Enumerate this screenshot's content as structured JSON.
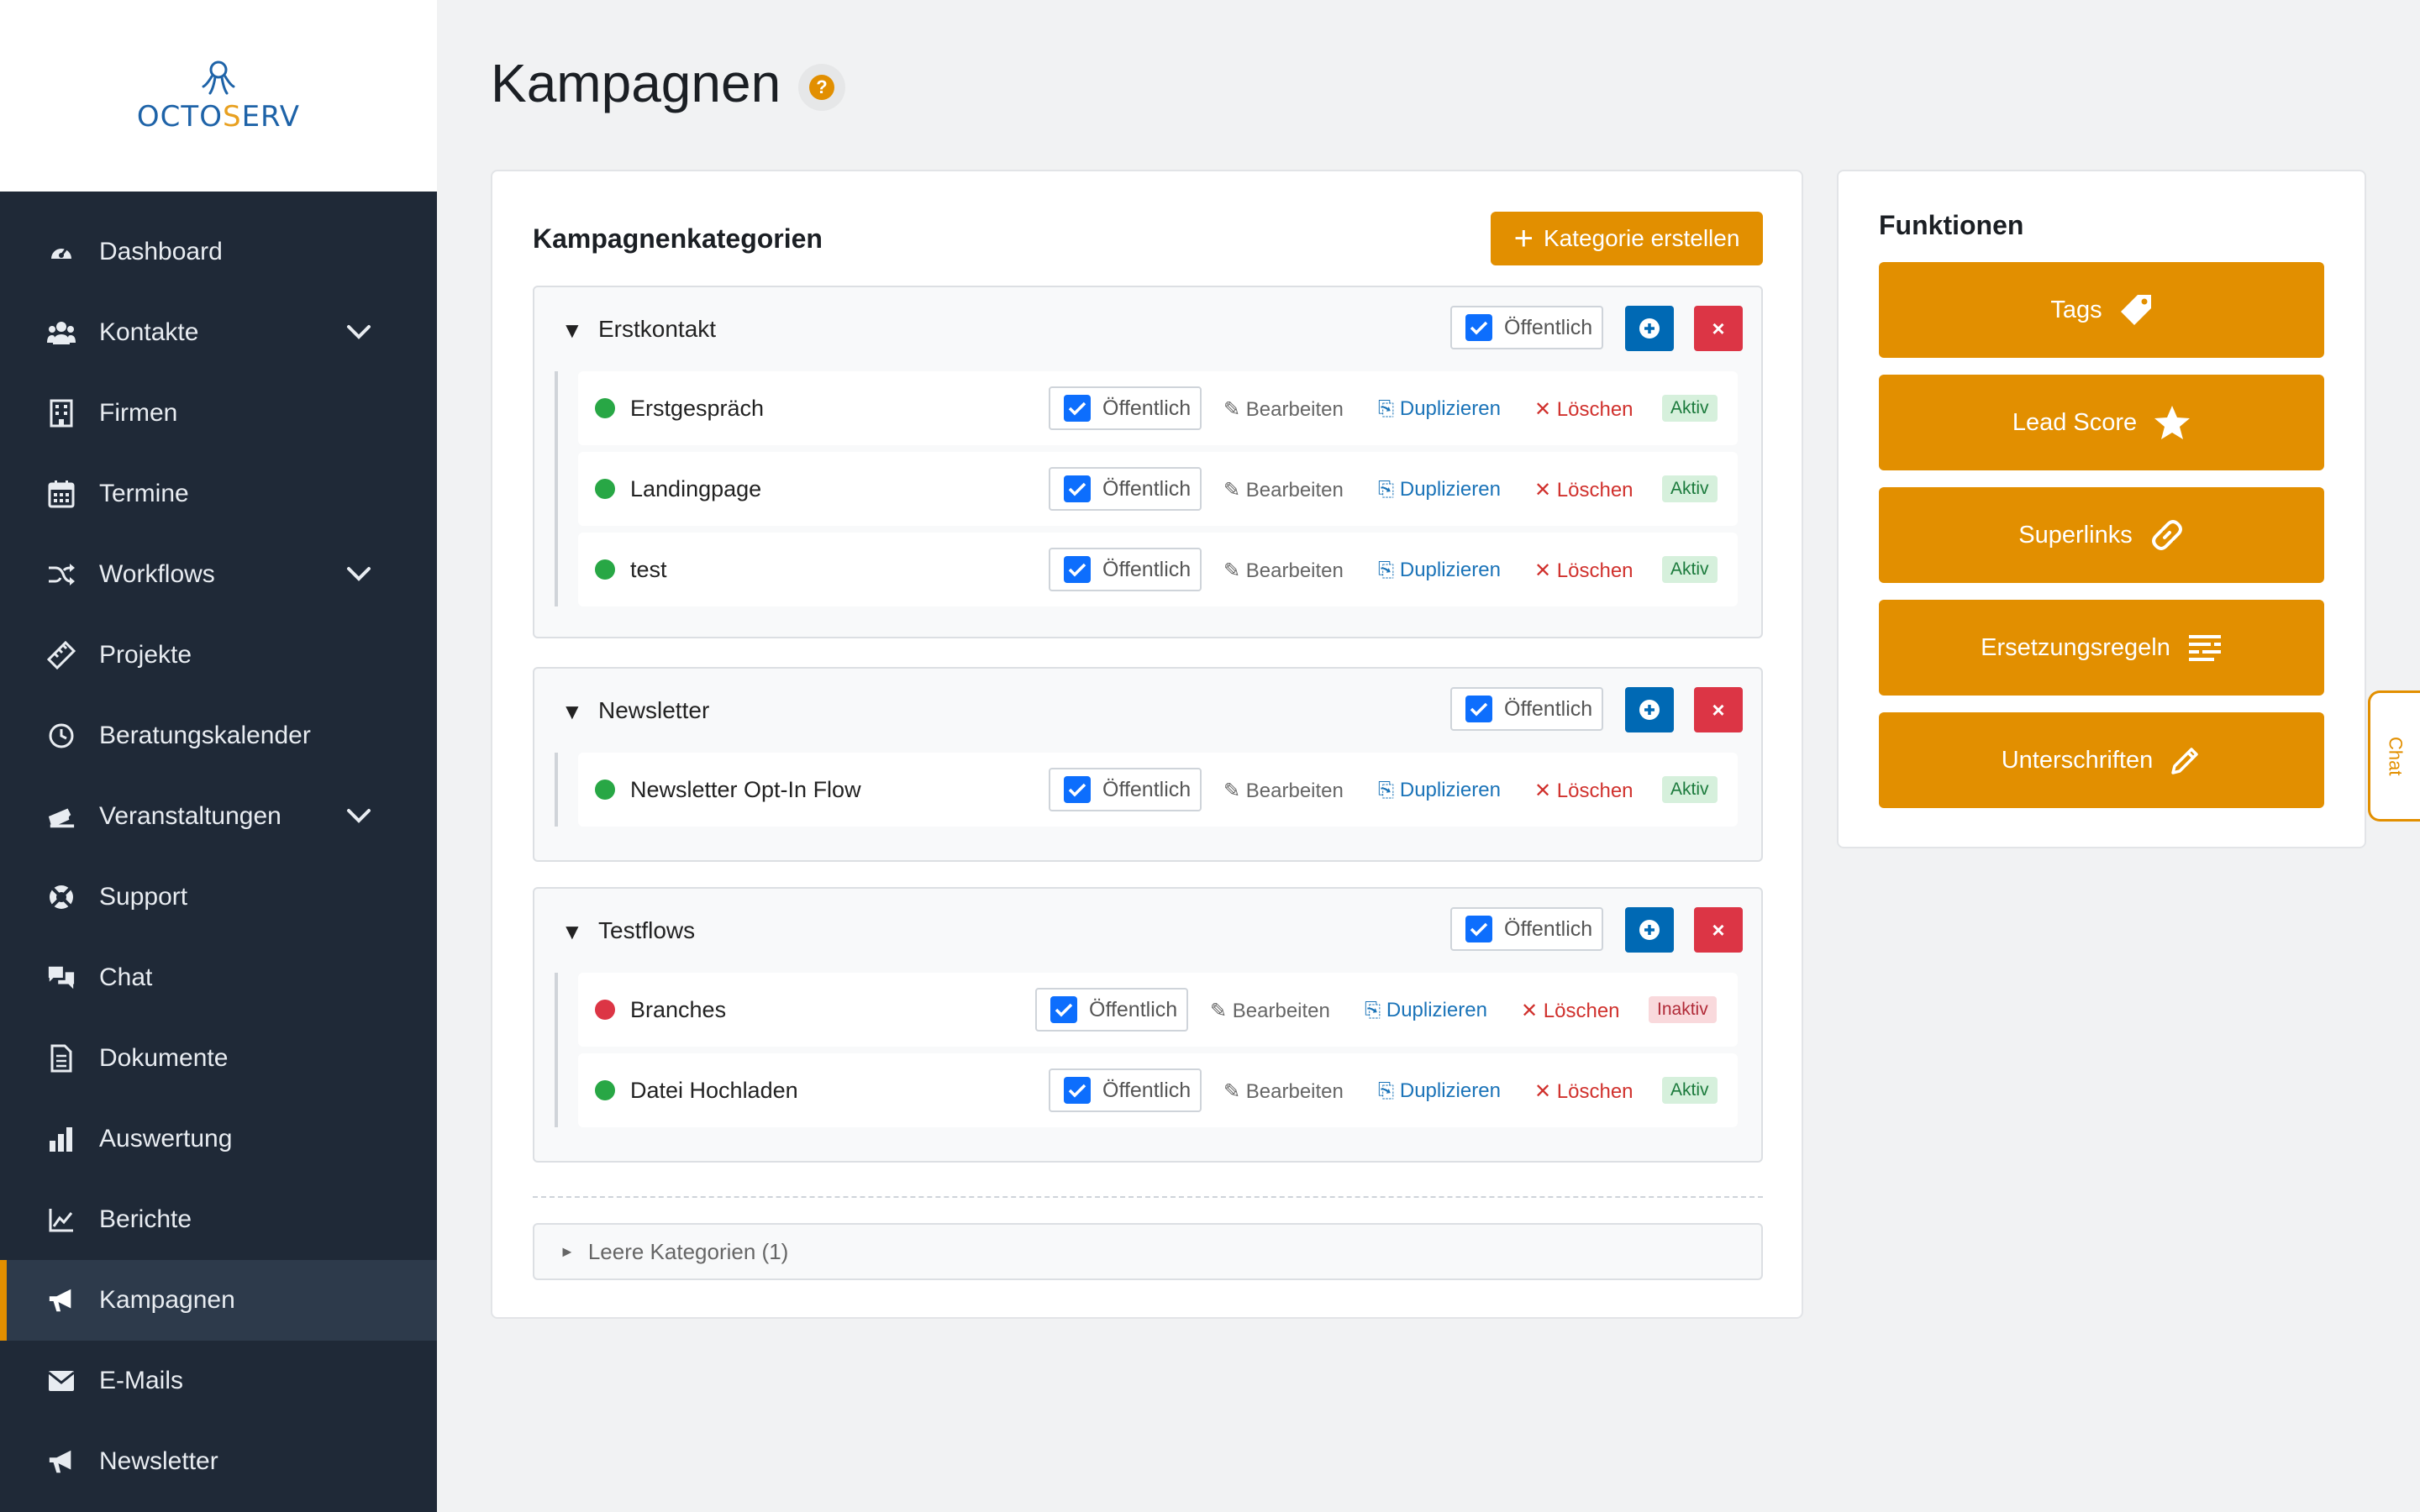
{
  "app": {
    "logo_text_a": "OCTO",
    "logo_text_b": "S",
    "logo_text_c": "ERV",
    "brand_color": "#e28f00",
    "sidebar_color": "#1f2937"
  },
  "sidebar": {
    "items": [
      {
        "label": "Dashboard",
        "icon": "dashboard-icon"
      },
      {
        "label": "Kontakte",
        "icon": "contacts-icon",
        "has_submenu": true
      },
      {
        "label": "Firmen",
        "icon": "building-icon"
      },
      {
        "label": "Termine",
        "icon": "calendar-icon"
      },
      {
        "label": "Workflows",
        "icon": "shuffle-icon",
        "has_submenu": true
      },
      {
        "label": "Projekte",
        "icon": "ruler-icon"
      },
      {
        "label": "Beratungskalender",
        "icon": "clock-icon"
      },
      {
        "label": "Veranstaltungen",
        "icon": "ticket-icon",
        "has_submenu": true
      },
      {
        "label": "Support",
        "icon": "lifebuoy-icon"
      },
      {
        "label": "Chat",
        "icon": "chat-icon"
      },
      {
        "label": "Dokumente",
        "icon": "document-icon"
      },
      {
        "label": "Auswertung",
        "icon": "bar-chart-icon"
      },
      {
        "label": "Berichte",
        "icon": "line-chart-icon"
      },
      {
        "label": "Kampagnen",
        "icon": "megaphone-icon",
        "active": true
      },
      {
        "label": "E-Mails",
        "icon": "envelope-icon"
      },
      {
        "label": "Newsletter",
        "icon": "megaphone-icon"
      }
    ]
  },
  "page": {
    "title": "Kampagnen",
    "help": "?"
  },
  "categories_card": {
    "heading": "Kampagnenkategorien",
    "create_button": "Kategorie erstellen",
    "public_label": "Öffentlich",
    "actions": {
      "edit": "✎ Bearbeiten",
      "duplicate": "⎘ Duplizieren",
      "delete": "✕ Löschen"
    },
    "status_labels": {
      "active": "Aktiv",
      "inactive": "Inaktiv"
    },
    "categories": [
      {
        "name": "Erstkontakt",
        "public": true,
        "flows": [
          {
            "name": "Erstgespräch",
            "public": true,
            "status": "Aktiv"
          },
          {
            "name": "Landingpage",
            "public": true,
            "status": "Aktiv"
          },
          {
            "name": "test",
            "public": true,
            "status": "Aktiv"
          }
        ]
      },
      {
        "name": "Newsletter",
        "public": true,
        "flows": [
          {
            "name": "Newsletter Opt-In Flow",
            "public": true,
            "status": "Aktiv"
          }
        ]
      },
      {
        "name": "Testflows",
        "public": true,
        "flows": [
          {
            "name": "Branches",
            "public": true,
            "status": "Inaktiv"
          },
          {
            "name": "Datei Hochladen",
            "public": true,
            "status": "Aktiv"
          }
        ]
      }
    ],
    "empty_categories": "Leere Kategorien (1)"
  },
  "functions_card": {
    "heading": "Funktionen",
    "buttons": [
      {
        "label": "Tags",
        "icon": "tag-icon"
      },
      {
        "label": "Lead Score",
        "icon": "star-icon"
      },
      {
        "label": "Superlinks",
        "icon": "link-icon"
      },
      {
        "label": "Ersetzungsregeln",
        "icon": "text-lines-icon"
      },
      {
        "label": "Unterschriften",
        "icon": "pencil-icon"
      }
    ]
  },
  "chat_tab": {
    "label": "Chat"
  }
}
